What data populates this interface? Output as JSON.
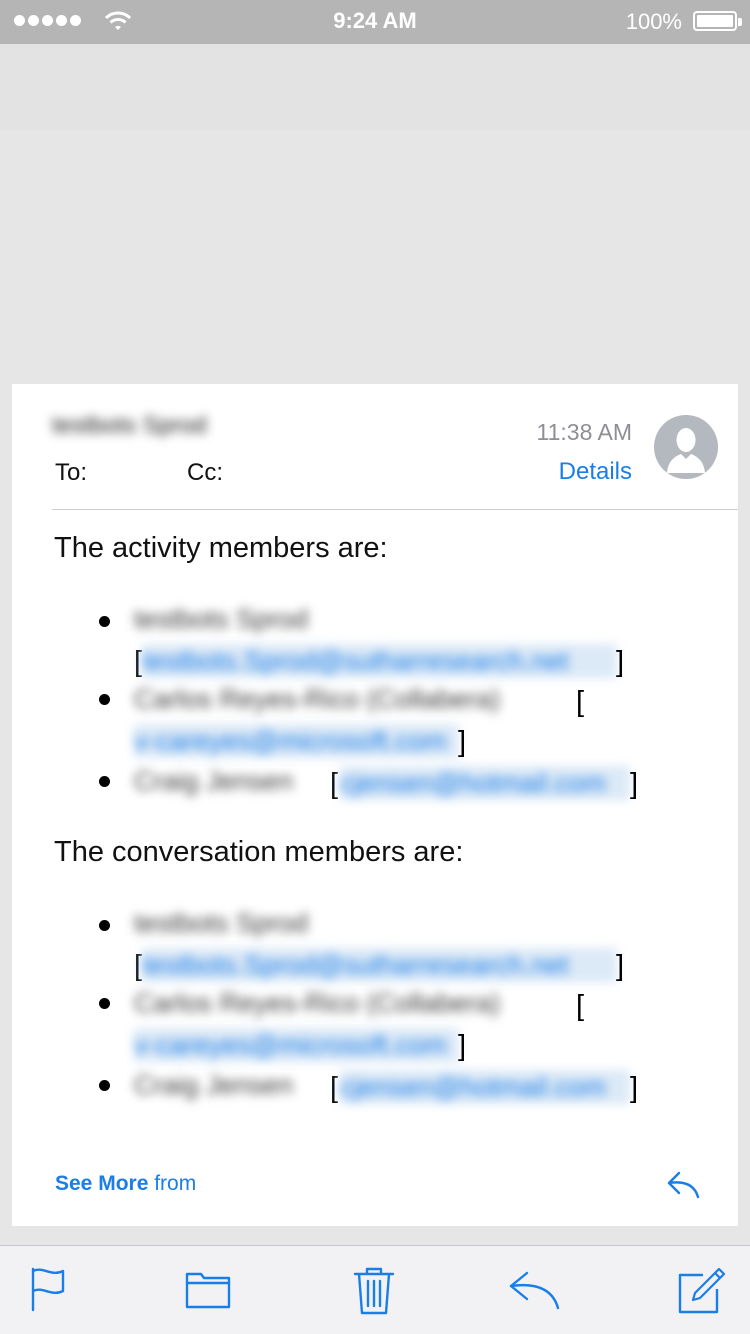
{
  "status_bar": {
    "time": "9:24 AM",
    "battery_percent": "100%",
    "signal_bars": 5
  },
  "message": {
    "sender": "testbots Sprod",
    "time": "11:38 AM",
    "to_label": "To:",
    "cc_label": "Cc:",
    "details_label": "Details",
    "activity_heading": "The activity members are:",
    "activity_members": [
      {
        "name": "testbots Sprod",
        "email": "testbots.Sprod@sutharresearch.net"
      },
      {
        "name": "Carlos Reyes-Rico (Collabera)",
        "email": "v-careyes@microsoft.com"
      },
      {
        "name": "Craig Jensen",
        "email": "cjensen@hotmail.com"
      }
    ],
    "conversation_heading": "The conversation members are:",
    "conversation_members": [
      {
        "name": "testbots Sprod",
        "email": "testbots.Sprod@sutharresearch.net"
      },
      {
        "name": "Carlos Reyes-Rico (Collabera)",
        "email": "v-careyes@microsoft.com"
      },
      {
        "name": "Craig Jensen",
        "email": "cjensen@hotmail.com"
      }
    ],
    "see_more_label": "See More",
    "see_more_from": "from"
  },
  "toolbar": {
    "items": [
      "flag-icon",
      "folder-icon",
      "trash-icon",
      "reply-icon",
      "compose-icon"
    ]
  },
  "colors": {
    "accent": "#1a7ee6",
    "background": "#e6e6e6",
    "card": "#ffffff",
    "toolbar": "#f2f2f4"
  }
}
